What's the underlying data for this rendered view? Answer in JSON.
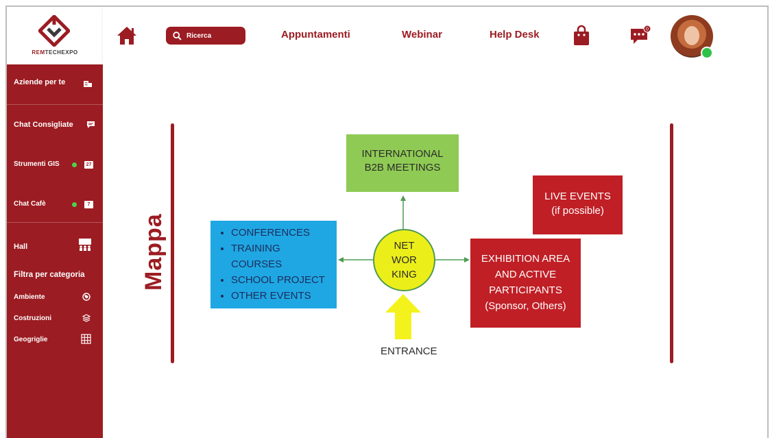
{
  "brand": {
    "logo_text_a": "REM",
    "logo_text_b": "TECH",
    "logo_text_c": "EXPO",
    "color": "#9b1c22"
  },
  "topbar": {
    "search_placeholder": "Ricerca",
    "nav": [
      "Appuntamenti",
      "Webinar",
      "Help Desk"
    ],
    "icons": [
      "home-icon",
      "search-icon",
      "shopping-bag-icon",
      "chat-bubble-icon"
    ],
    "chat_badge": "0"
  },
  "sidebar": {
    "aziende": "Aziende per te",
    "chat_consigliate": "Chat Consigliate",
    "strumenti_gis": "Strumenti GIS",
    "strumenti_count": "27",
    "chat_cafe": "Chat Cafè",
    "chat_cafe_count": "7",
    "hall": "Hall",
    "filtra": "Filtra per categoria",
    "categories": [
      "Ambiente",
      "Costruzioni",
      "Geogriglie"
    ]
  },
  "map": {
    "title": "Mappa",
    "b2b_line1": "INTERNATIONAL",
    "b2b_line2": "B2B MEETINGS",
    "live_line1": "LIVE EVENTS",
    "live_line2": "(if possible)",
    "events": [
      "CONFERENCES",
      "TRAINING",
      "COURSES",
      "SCHOOL PROJECT",
      "OTHER EVENTS"
    ],
    "networking": [
      "NET",
      "WOR",
      "KING"
    ],
    "exhibition": [
      "EXHIBITION AREA",
      "AND ACTIVE",
      "PARTICIPANTS",
      "(Sponsor, Others)"
    ],
    "entrance": "ENTRANCE",
    "colors": {
      "green": "#8fcb54",
      "blue": "#1fa7e3",
      "red": "#c01f26",
      "yellow": "#ecee1a",
      "arrow": "#4f9b50"
    }
  }
}
